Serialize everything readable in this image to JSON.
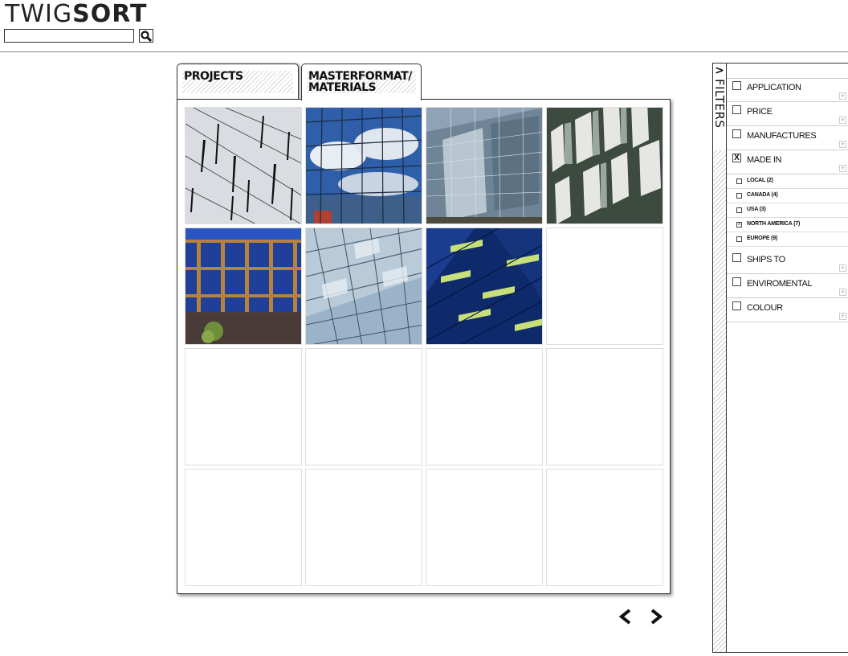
{
  "app": {
    "logo_light": "TWIG",
    "logo_bold": "SORT"
  },
  "search": {
    "value": "",
    "placeholder": "",
    "icon": "magnifier-icon"
  },
  "tabs": [
    {
      "label": "PROJECTS",
      "active": false
    },
    {
      "label": "MASTERFORMAT/ MATERIALS",
      "active": true
    }
  ],
  "gallery": {
    "images": [
      {
        "kind": "building-photo",
        "theme": "silver-fins"
      },
      {
        "kind": "building-photo",
        "theme": "blue-sky-reflection"
      },
      {
        "kind": "building-photo",
        "theme": "glass-tower"
      },
      {
        "kind": "building-photo",
        "theme": "angled-panels"
      },
      {
        "kind": "building-photo",
        "theme": "wood-frame-windows"
      },
      {
        "kind": "building-photo",
        "theme": "pale-blue-grid"
      },
      {
        "kind": "building-photo",
        "theme": "dark-blue-green"
      }
    ],
    "total_cells": 16
  },
  "pager": {
    "prev_icon": "chevron-left-icon",
    "next_icon": "chevron-right-icon"
  },
  "filters": {
    "toggle": ">",
    "title": "FILTERS",
    "groups": [
      {
        "label": "APPLICATION",
        "checked": false
      },
      {
        "label": "PRICE",
        "checked": false
      },
      {
        "label": "MANUFACTURES",
        "checked": false
      },
      {
        "label": "MADE IN",
        "checked": true,
        "mark": "X"
      },
      {
        "label": "SHIPS TO",
        "checked": false
      },
      {
        "label": "ENVIROMENTAL",
        "checked": false
      },
      {
        "label": "COLOUR",
        "checked": false
      }
    ],
    "made_in_options": [
      {
        "label": "LOCAL (2)",
        "checked": false
      },
      {
        "label": "CANADA (4)",
        "checked": false
      },
      {
        "label": "USA (3)",
        "checked": false
      },
      {
        "label": "NORTH AMERICA (7)",
        "checked": true,
        "mark": "x"
      },
      {
        "label": "EUROPE (9)",
        "checked": false
      }
    ],
    "expand_icon": "plus-icon"
  }
}
